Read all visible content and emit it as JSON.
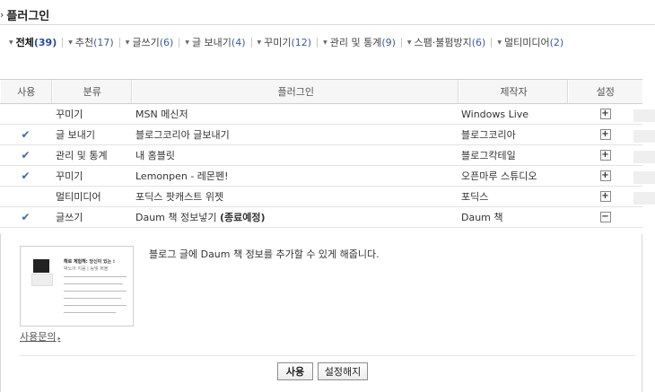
{
  "page": {
    "title": "플러그인"
  },
  "filters": [
    {
      "label": "전체",
      "count": "(39)"
    },
    {
      "label": "추천",
      "count": "(17)"
    },
    {
      "label": "글쓰기",
      "count": "(6)"
    },
    {
      "label": "글 보내기",
      "count": "(4)"
    },
    {
      "label": "꾸미기",
      "count": "(12)"
    },
    {
      "label": "관리 및 통계",
      "count": "(9)"
    },
    {
      "label": "스팸·불펌방지",
      "count": "(6)"
    },
    {
      "label": "멀티미디어",
      "count": "(2)"
    }
  ],
  "table": {
    "headers": {
      "use": "사용",
      "category": "분류",
      "plugin": "플러그인",
      "maker": "제작자",
      "settings": "설정"
    },
    "rows": [
      {
        "used": false,
        "category": "꾸미기",
        "plugin": "MSN 메신저",
        "maker": "Windows Live",
        "toggle": "+"
      },
      {
        "used": true,
        "category": "글 보내기",
        "plugin": "블로그코리아 글보내기",
        "maker": "블로그코리아",
        "toggle": "+"
      },
      {
        "used": true,
        "category": "관리 및 통계",
        "plugin": "내 홈블릿",
        "maker": "블로그칵테일",
        "toggle": "+"
      },
      {
        "used": true,
        "category": "꾸미기",
        "plugin": "Lemonpen - 레몬펜!",
        "maker": "오픈마루 스튜디오",
        "toggle": "+"
      },
      {
        "used": false,
        "category": "멀티미디어",
        "plugin": "포딕스 팟캐스트 위젯",
        "maker": "포딕스",
        "toggle": "+"
      },
      {
        "used": true,
        "category": "글쓰기",
        "plugin": "Daum 책 정보넣기",
        "plugin_note": "(종료예정)",
        "maker": "Daum 책",
        "toggle": "−"
      }
    ],
    "check_mark": "✔"
  },
  "detail": {
    "description": "블로그 글에 Daum 책 정보를 추가할 수 있게 해줍니다.",
    "inquiry_link": "사용문의",
    "use_button": "사용",
    "unset_button": "설정해지",
    "thumb_title": "해로 체험해: 당신이 있는 ⁝",
    "thumb_sub": "박노아 지음 | 능빛 퍼블"
  }
}
